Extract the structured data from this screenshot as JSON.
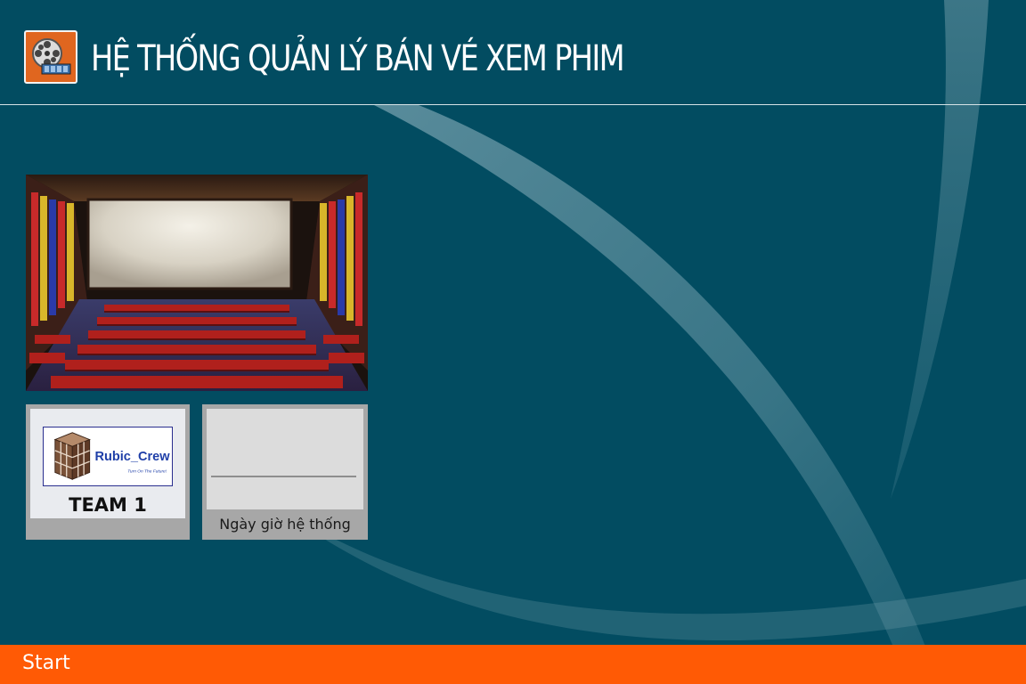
{
  "header": {
    "title": "HỆ THỐNG QUẢN LÝ BÁN VÉ XEM PHIM",
    "logo_icon": "film-reel-icon"
  },
  "tiles": {
    "cinema_image": {
      "icon": "cinema-hall-image"
    },
    "team": {
      "logo_text": "Rubic_Crew",
      "logo_tagline": "Turn On The Future!",
      "name": "TEAM 1"
    },
    "clock": {
      "label": "Ngày giờ hệ thống",
      "time": "",
      "date": ""
    }
  },
  "taskbar": {
    "start_label": "Start"
  },
  "colors": {
    "background": "#024c61",
    "accent": "#ff5a05",
    "logo_bg": "#e0661f",
    "tile_border": "#a7a7a7"
  }
}
